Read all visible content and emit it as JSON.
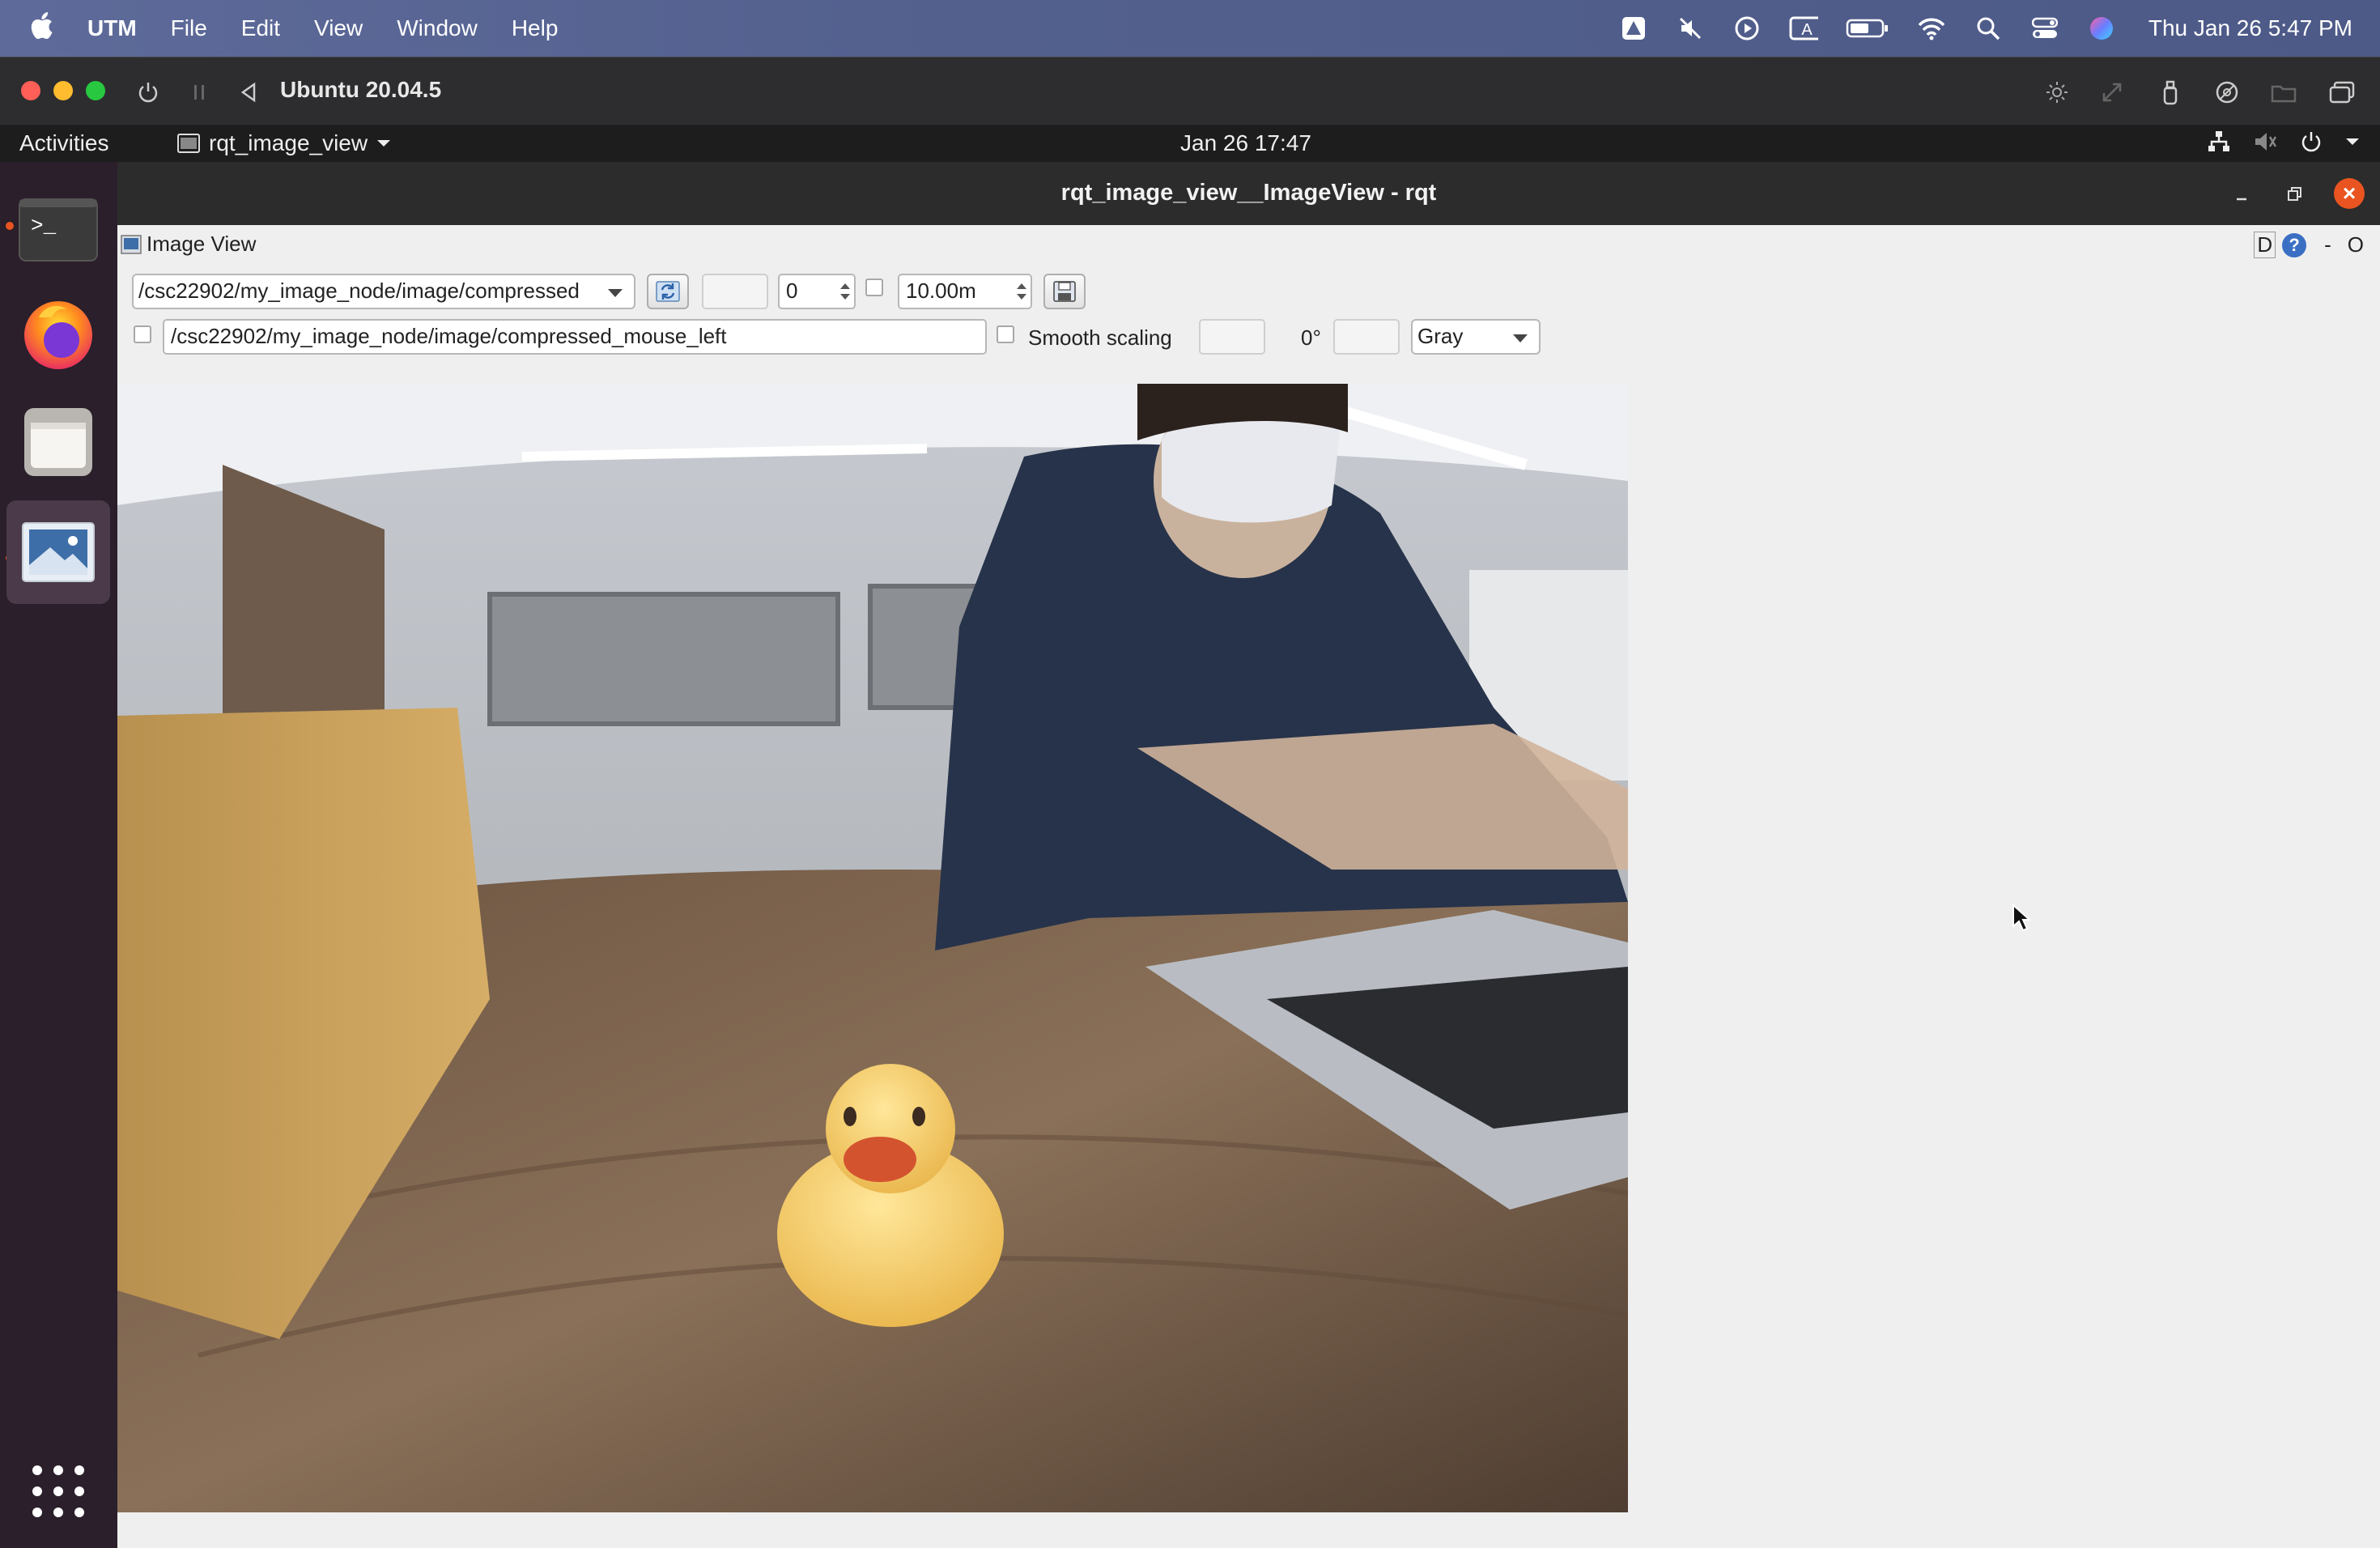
{
  "mac_menubar": {
    "app": "UTM",
    "menus": [
      "File",
      "Edit",
      "View",
      "Window",
      "Help"
    ],
    "status_icons": [
      "drive-icon",
      "mute-icon",
      "play-icon",
      "keyboard-a-icon",
      "battery-icon",
      "wifi-icon",
      "search-icon",
      "control-center-icon",
      "siri-icon"
    ],
    "clock": "Thu Jan 26  5:47 PM"
  },
  "utm_window": {
    "title": "Ubuntu 20.04.5",
    "toolbar_icons": [
      "power-icon",
      "pause-icon",
      "back-icon",
      "brightness-icon",
      "resize-icon",
      "usb-icon",
      "drive-icon",
      "folder-icon",
      "windows-icon"
    ]
  },
  "gnome_bar": {
    "activities": "Activities",
    "app_name": "rqt_image_view",
    "datetime": "Jan 26  17:47"
  },
  "dock": {
    "items": [
      "terminal",
      "firefox",
      "files",
      "image-viewer"
    ],
    "apps_grid": "show-applications"
  },
  "rqt_window": {
    "title": "rqt_image_view__ImageView - rqt",
    "close_label": "×"
  },
  "image_view": {
    "dock_title": "Image View",
    "dock_right_d": "D",
    "dock_right_help": "?",
    "dock_right_dash": "-",
    "dock_right_o": "O",
    "topic": "/csc22902/my_image_node/image/compressed",
    "spin_value": "0",
    "timeout": "10.00m",
    "mouse_topic": "/csc22902/my_image_node/image/compressed_mouse_left",
    "smooth_scaling_label": "Smooth scaling",
    "rotation_label": "0°",
    "color_scheme": "Gray",
    "smooth_scaling_checked": false,
    "publish_mouse_checked": false
  },
  "colors": {
    "mac_bar": "#55628f",
    "window_bg": "#efefef",
    "ubuntu_orange": "#e95420",
    "close_red": "#e95420"
  }
}
